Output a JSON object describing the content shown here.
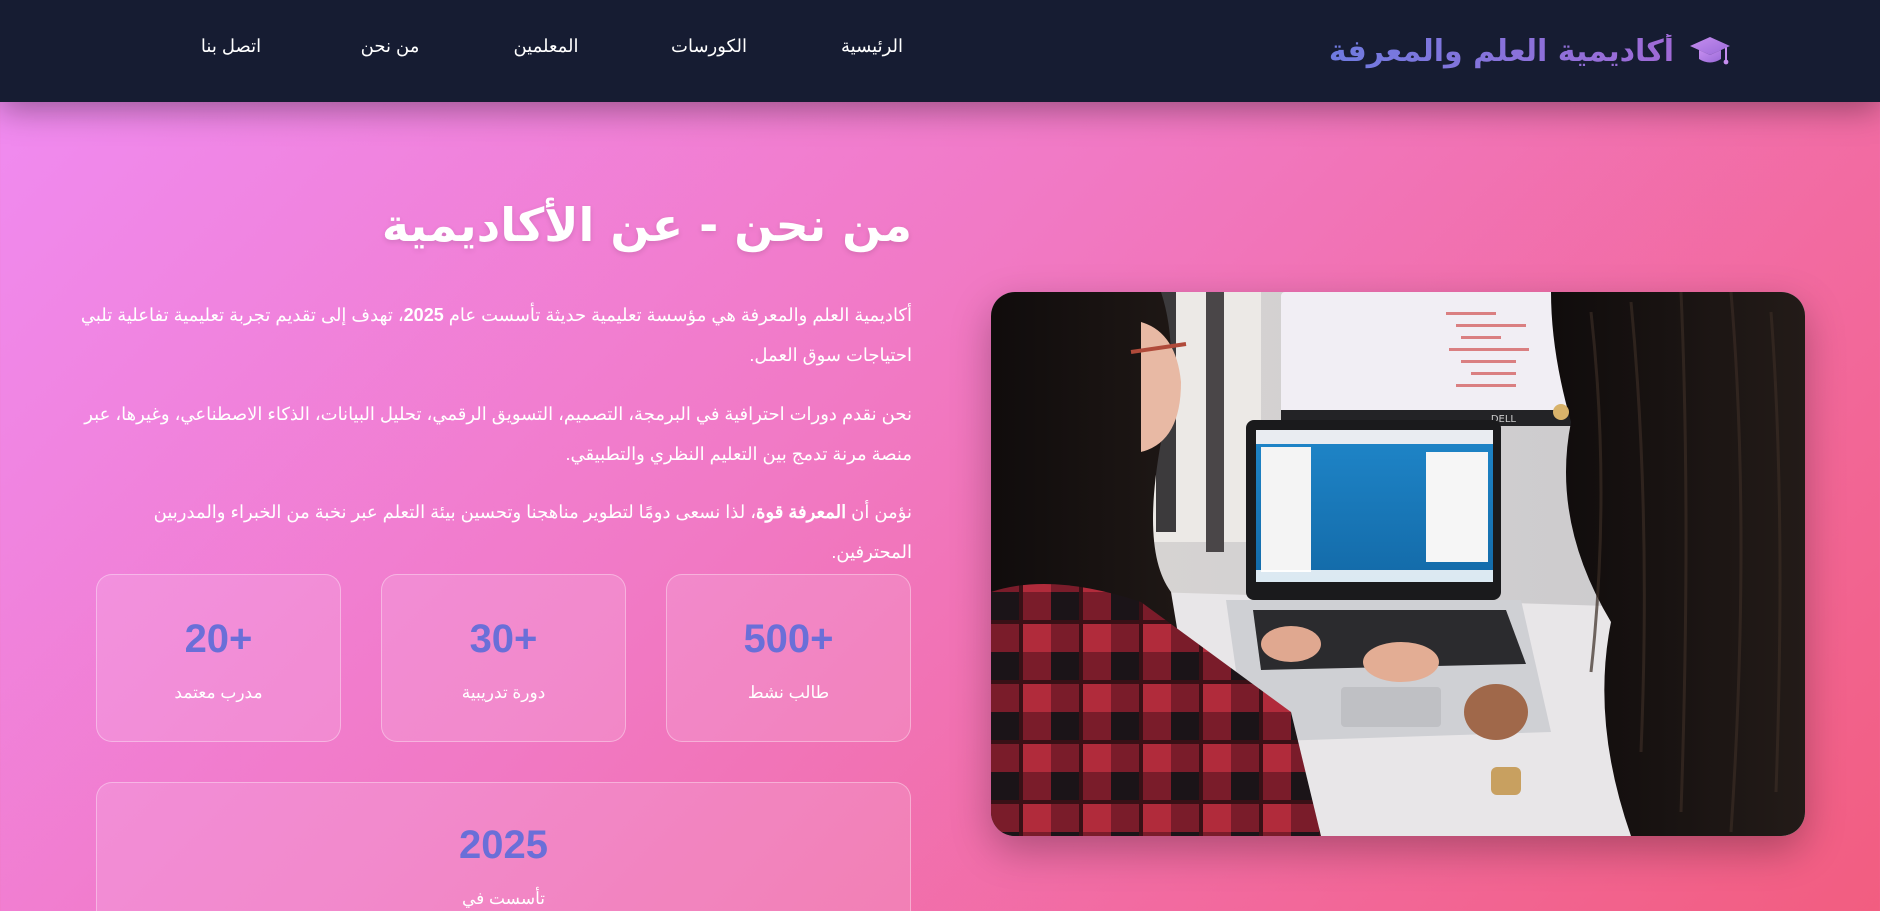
{
  "brand": {
    "name": "أكاديمية العلم والمعرفة",
    "icon": "graduation-cap-icon",
    "gradient": [
      "#6f7be0",
      "#a06ad6"
    ]
  },
  "nav": {
    "home": "الرئيسية",
    "courses": "الكورسات",
    "teachers": "المعلمين",
    "about": "من نحن",
    "contact": "اتصل بنا"
  },
  "about": {
    "title": "من نحن - عن الأكاديمية",
    "p1_a": "أكاديمية العلم والمعرفة هي مؤسسة تعليمية حديثة تأسست عام ",
    "p1_year": "2025",
    "p1_b": "، تهدف إلى تقديم تجربة تعليمية تفاعلية تلبي احتياجات سوق العمل.",
    "p2": "نحن نقدم دورات احترافية في البرمجة، التصميم، التسويق الرقمي، تحليل البيانات، الذكاء الاصطناعي، وغيرها، عبر منصة مرنة تدمج بين التعليم النظري والتطبيقي.",
    "p3_a": "نؤمن أن ",
    "p3_bold": "المعرفة قوة",
    "p3_b": "، لذا نسعى دومًا لتطوير مناهجنا وتحسين بيئة التعلم عبر نخبة من الخبراء والمدربين المحترفين."
  },
  "stats": [
    {
      "value": "500+",
      "label": "طالب نشط"
    },
    {
      "value": "30+",
      "label": "دورة تدريبية"
    },
    {
      "value": "20+",
      "label": "مدرب معتمد"
    }
  ],
  "founded": {
    "value": "2025",
    "label": "تأسست في"
  },
  "colors": {
    "navbar": "#161c32",
    "accent": "#6a6fd8",
    "bg_start": "#f08cf4",
    "bg_end": "#f25d80"
  },
  "image": {
    "subject": "students-working-on-laptop"
  }
}
